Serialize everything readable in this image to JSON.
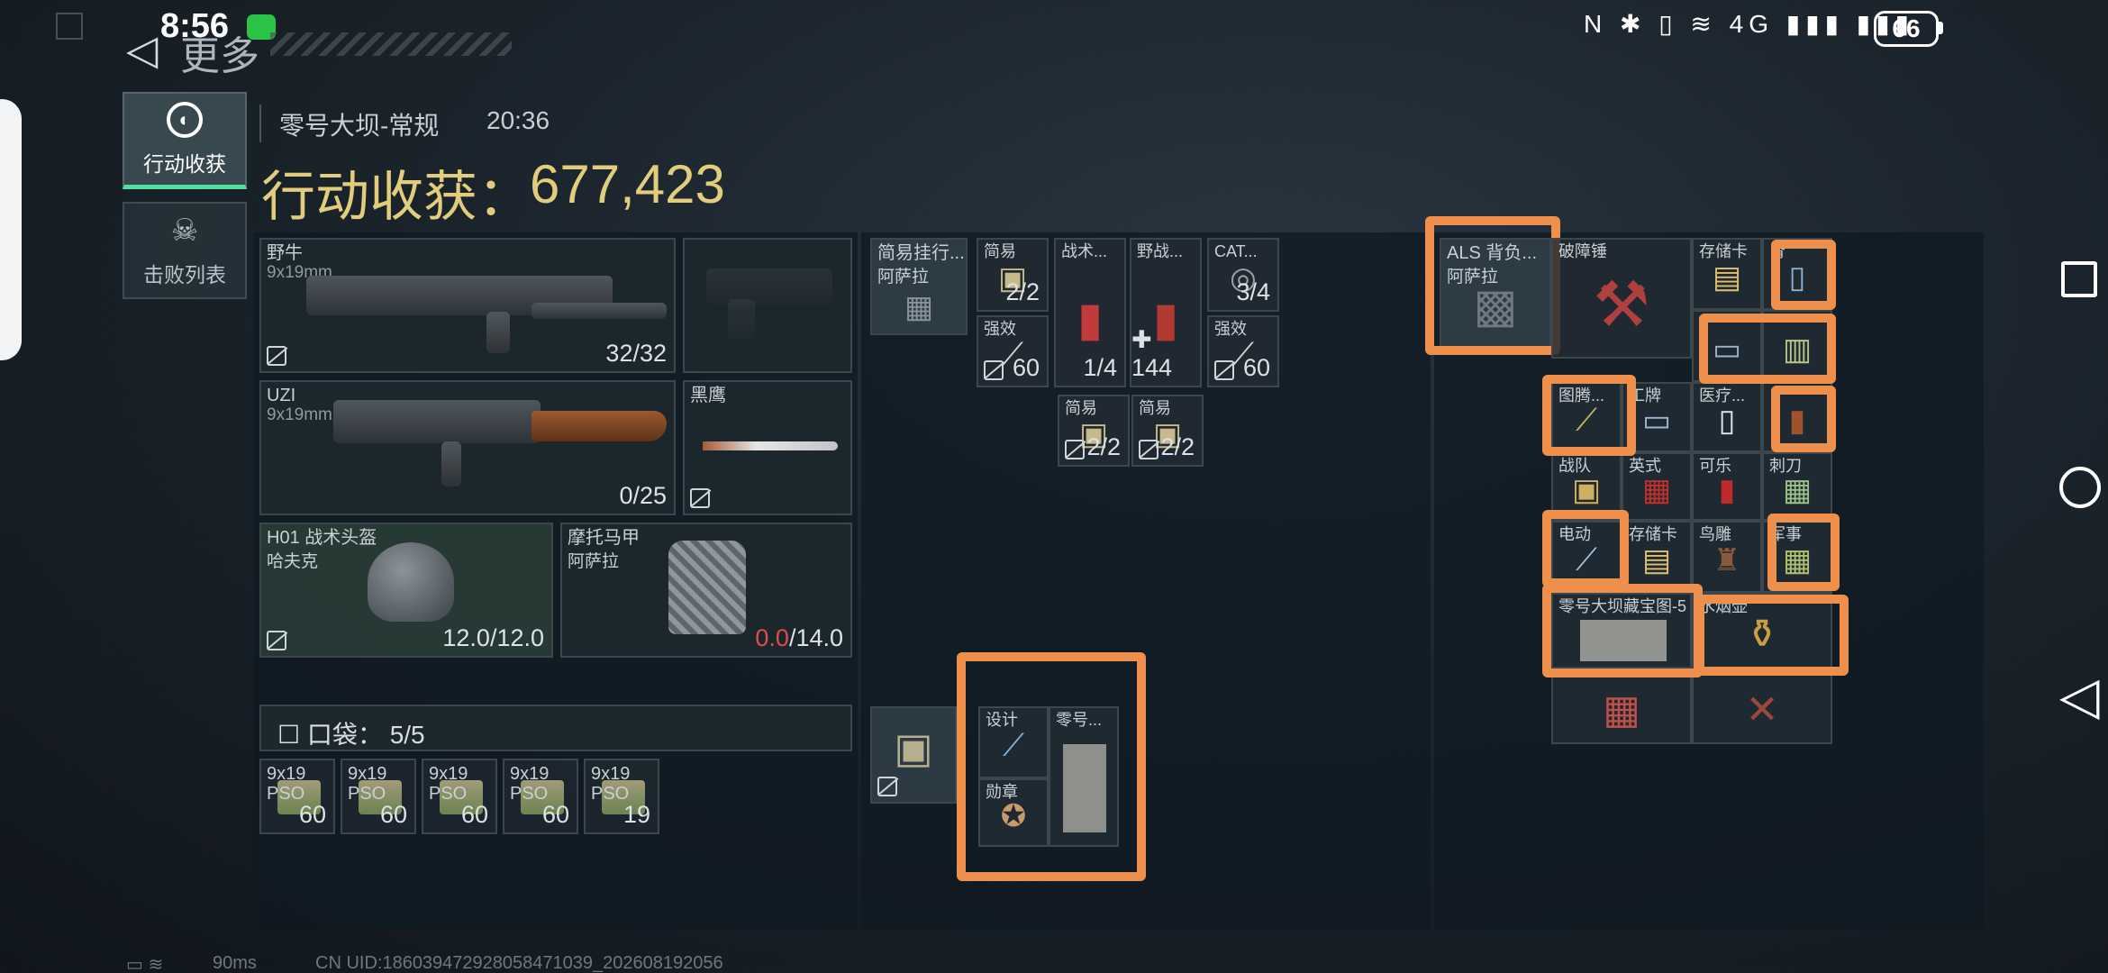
{
  "status_bar": {
    "time": "8:56",
    "battery": "66",
    "icons": "N ✱ ▯ ≋ 4G ▮▮▮ ▮▮▮"
  },
  "header": {
    "back_icon": "back-arrow-icon",
    "title": "更多"
  },
  "tabs": [
    {
      "label": "行动收获",
      "icon": "target-icon",
      "active": true
    },
    {
      "label": "击败列表",
      "icon": "skull-icon",
      "active": false
    }
  ],
  "mission": {
    "map": "零号大坝-常规",
    "time": "20:36",
    "loot_label": "行动收获：",
    "loot_value": "677,423"
  },
  "weapons": [
    {
      "name": "野牛",
      "caliber": "9x19mm",
      "ammo": "32/32"
    },
    {
      "name": "UZI",
      "caliber": "9x19mm",
      "ammo": "0/25"
    },
    {
      "name": "黑鹰",
      "caliber": "",
      "ammo": ""
    }
  ],
  "armor": [
    {
      "name": "H01 战术头盔",
      "brand": "哈夫克",
      "dur_current": "12.0",
      "dur_max": "/12.0"
    },
    {
      "name": "摩托马甲",
      "brand": "阿萨拉",
      "dur_current": "0.0",
      "dur_max": "/14.0"
    }
  ],
  "pocket": {
    "label": "口袋：",
    "count": "5/5",
    "items": [
      {
        "name": "9x19 PSO",
        "count": "60"
      },
      {
        "name": "9x19 PSO",
        "count": "60"
      },
      {
        "name": "9x19 PSO",
        "count": "60"
      },
      {
        "name": "9x19 PSO",
        "count": "60"
      },
      {
        "name": "9x19 PSO",
        "count": "19"
      }
    ]
  },
  "rig": {
    "name": "简易挂行...",
    "brand": "阿萨拉",
    "items": [
      {
        "name": "简易",
        "count": "2/2"
      },
      {
        "name": "战术...",
        "count": "1/4"
      },
      {
        "name": "野战...",
        "count": "144"
      },
      {
        "name": "CAT...",
        "count": "3/4"
      },
      {
        "name": "强效",
        "count": "60"
      },
      {
        "name": "强效",
        "count": "60"
      },
      {
        "name": "简易",
        "count": "2/2"
      },
      {
        "name": "简易",
        "count": "2/2"
      }
    ]
  },
  "safe_box": {
    "items": [
      {
        "name": "设计"
      },
      {
        "name": "零号..."
      },
      {
        "name": "勋章"
      }
    ]
  },
  "backpack": {
    "name": "ALS 背负...",
    "brand": "阿萨拉",
    "items": [
      {
        "name": "破障锤"
      },
      {
        "name": "存储卡"
      },
      {
        "name": "肾"
      },
      {
        "name": "图腾..."
      },
      {
        "name": "工牌"
      },
      {
        "name": "医疗..."
      },
      {
        "name": "战队"
      },
      {
        "name": "英式"
      },
      {
        "name": "可乐"
      },
      {
        "name": "刺刀"
      },
      {
        "name": "电动"
      },
      {
        "name": "存储卡"
      },
      {
        "name": "鸟雕"
      },
      {
        "name": "军事"
      },
      {
        "name": "零号大坝藏宝图-5"
      },
      {
        "name": "水烟壶"
      }
    ]
  },
  "footer": {
    "ping": "90ms",
    "uid": "CN UID:18603947292805847103​9_202608192056"
  },
  "colors": {
    "loot_gold": "#e2cd7c",
    "highlight": "#ef8f4c",
    "active_tab": "#4de0a0",
    "broken": "#e04c4c"
  }
}
